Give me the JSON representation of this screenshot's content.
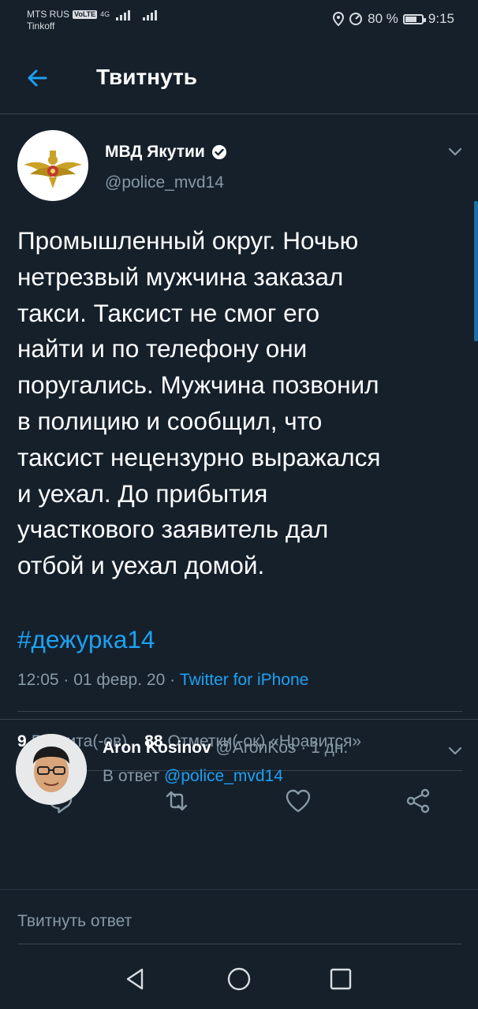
{
  "status_bar": {
    "carrier": "MTS RUS",
    "volte": "VoLTE",
    "network": "4G",
    "operator2": "Tinkoff",
    "battery": "80 %",
    "battery_level": 0.8,
    "time": "9:15"
  },
  "header": {
    "back_icon": "arrow-left-icon",
    "title": "Твитнуть"
  },
  "tweet": {
    "author_name": "МВД Якутии",
    "verified_icon": "verified-badge-icon",
    "handle": "@police_mvd14",
    "text": "Промышленный округ. Ночью\nнетрезвый мужчина заказал\nтакси. Таксист не смог его\nнайти и по телефону они\nпоругались. Мужчина позвонил\nв полицию и сообщил, что\nтаксист нецензурно выражался\nи уехал. До прибытия\nучасткового заявитель дал\nотбой и уехал домой.",
    "hashtag": "#дежурка14",
    "time": "12:05",
    "date": "01 февр. 20",
    "source": "Twitter for iPhone",
    "retweets_count": "9",
    "retweets_label": "Ретвита(-ов)",
    "likes_count": "88",
    "likes_label": "Отметки(-ок) «Нравится»",
    "actions": [
      "reply-icon",
      "retweet-icon",
      "like-icon",
      "share-icon"
    ]
  },
  "reply": {
    "author_name": "Aron Kosinov",
    "handle": "@AronKos",
    "age": "1 дн.",
    "reply_to_prefix": "В ответ",
    "reply_to_handle": "@police_mvd14"
  },
  "composer": {
    "placeholder": "Твитнуть ответ"
  },
  "nav": [
    "back-triangle-icon",
    "home-circle-icon",
    "recents-square-icon"
  ],
  "colors": {
    "background": "#15202b",
    "accent": "#1da1f2",
    "secondary_text": "#8899a6",
    "divider": "#38444d"
  }
}
